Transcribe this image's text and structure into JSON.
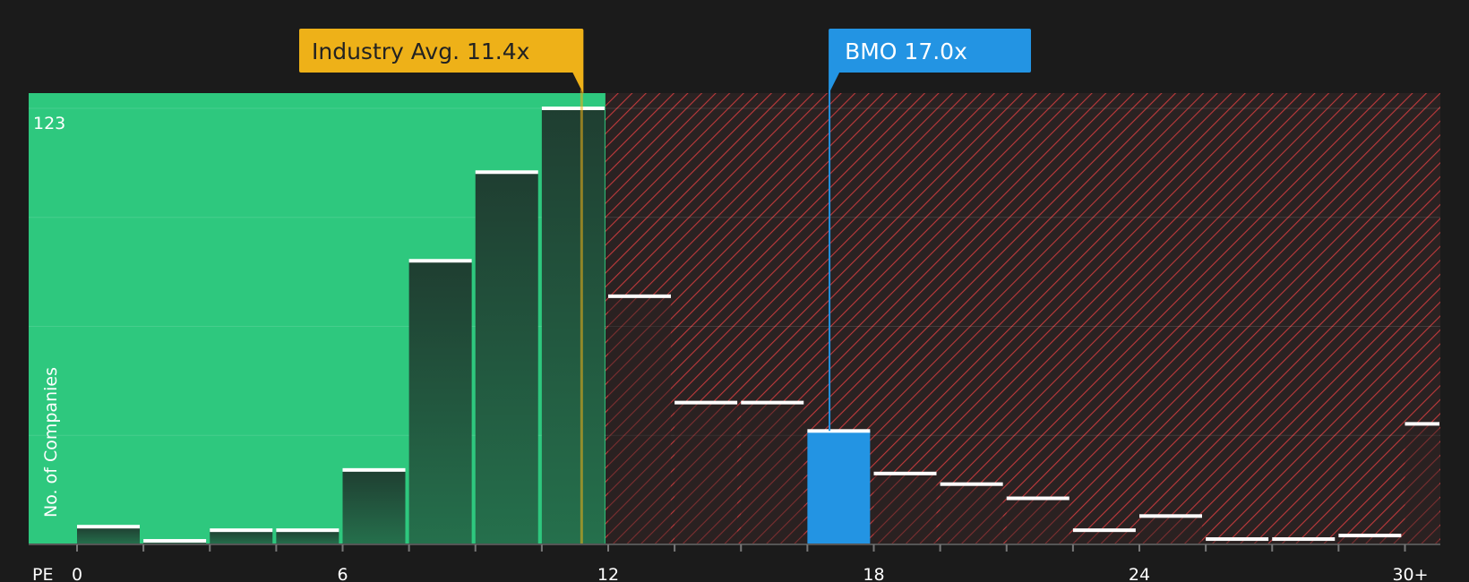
{
  "chart_data": {
    "type": "bar",
    "xlabel": "PE",
    "ylabel": "No. of Companies",
    "ymax_label": "123",
    "ylim": [
      0,
      123
    ],
    "bin_width": 1.5,
    "x_start": 0,
    "x_ticks": [
      0,
      6,
      12,
      18,
      24
    ],
    "x_last_tick_label": "30+",
    "values": [
      5,
      1,
      4,
      4,
      21,
      80,
      105,
      123,
      70,
      40,
      40,
      32,
      20,
      17,
      13,
      4,
      8,
      1.5,
      1.5,
      2.5,
      34
    ],
    "highlight_bar_index": 11,
    "fair_range_max": 11.4,
    "grid": true,
    "industry_avg": {
      "label": "Industry Avg. 11.4x",
      "value": 11.4,
      "color": "#eeb118"
    },
    "company": {
      "label": "BMO 17.0x",
      "value": 17.0,
      "color": "#2394e3"
    },
    "colors": {
      "green_zone": "#2ec87e",
      "red_zone": "#8e2d2e",
      "bar_dark": "#214a36",
      "bar_on_red": "#2a2222",
      "highlight": "#2394e3",
      "background": "#1b1b1b"
    }
  }
}
